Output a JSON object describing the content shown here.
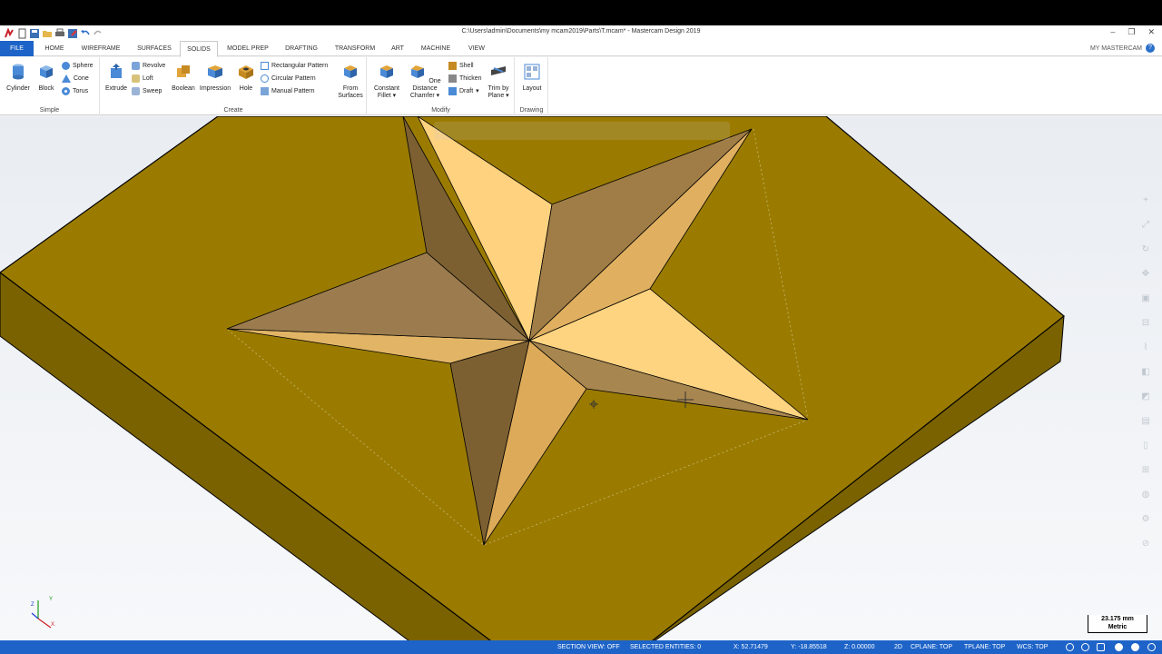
{
  "window": {
    "title": "C:\\Users\\admin\\Documents\\my mcam2019\\Parts\\T.mcam* - Mastercam Design 2019"
  },
  "tabs": [
    {
      "label": "FILE"
    },
    {
      "label": "HOME"
    },
    {
      "label": "WIREFRAME"
    },
    {
      "label": "SURFACES"
    },
    {
      "label": "SOLIDS"
    },
    {
      "label": "MODEL PREP"
    },
    {
      "label": "DRAFTING"
    },
    {
      "label": "TRANSFORM"
    },
    {
      "label": "ART"
    },
    {
      "label": "MACHINE"
    },
    {
      "label": "VIEW"
    }
  ],
  "active_tab": "SOLIDS",
  "account_label": "MY MASTERCAM",
  "ribbon": {
    "simple": {
      "label": "Simple",
      "cylinder": "Cylinder",
      "block": "Block",
      "sphere": "Sphere",
      "cone": "Cone",
      "torus": "Torus"
    },
    "create": {
      "label": "Create",
      "extrude": "Extrude",
      "revolve": "Revolve",
      "loft": "Loft",
      "sweep": "Sweep",
      "boolean": "Boolean",
      "impression": "Impression",
      "hole": "Hole",
      "rect_pattern": "Rectangular Pattern",
      "circ_pattern": "Circular Pattern",
      "manual_pattern": "Manual Pattern",
      "from_surfaces_1": "From",
      "from_surfaces_2": "Surfaces"
    },
    "modify": {
      "label": "Modify",
      "fillet_1": "Constant",
      "fillet_2": "Fillet",
      "chamfer_1": "One Distance",
      "chamfer_2": "Chamfer",
      "shell": "Shell",
      "thicken": "Thicken",
      "draft": "Draft",
      "trim_1": "Trim by",
      "trim_2": "Plane"
    },
    "drawing": {
      "label": "Drawing",
      "layout": "Layout"
    }
  },
  "colors": {
    "accent": "#1e64c8",
    "plate_top": "#9a7b00",
    "plate_side": "#7a6200",
    "star_light": "#ffd27f",
    "star_mid": "#e2b15c",
    "star_dark": "#8a6a3a"
  },
  "right_toolbar_icons": [
    "zoom-in-icon",
    "fit-icon",
    "rotate-icon",
    "pan-icon",
    "view-cube-icon",
    "section-icon",
    "measure-icon",
    "hide-icon",
    "layer-icon",
    "level-icon",
    "clip-icon",
    "plane-icon",
    "shade-icon",
    "settings-icon",
    "no-entry-icon"
  ],
  "scale": {
    "value": "23.175 mm",
    "units": "Metric"
  },
  "status": {
    "section_view": "SECTION VIEW: OFF",
    "selected": "SELECTED ENTITIES: 0",
    "x": "X:  52.71479",
    "y": "Y:  -18.85518",
    "z": "Z:  0.00000",
    "mode": "2D",
    "cplane": "CPLANE: TOP",
    "tplane": "TPLANE: TOP",
    "wcs": "WCS: TOP"
  }
}
